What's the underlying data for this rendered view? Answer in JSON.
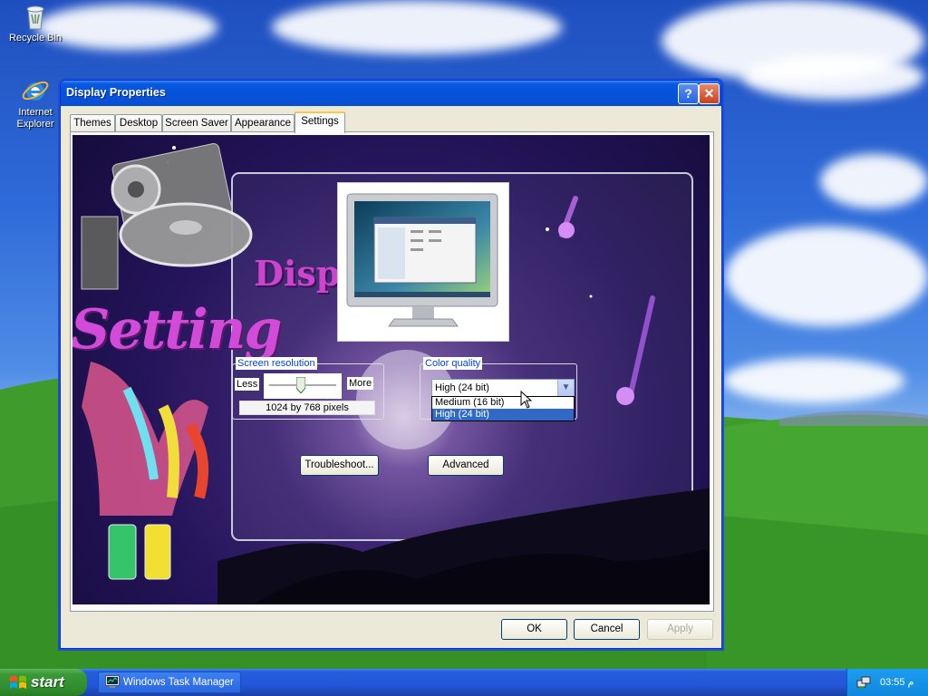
{
  "desktop": {
    "icons": [
      {
        "label": "Recycle Bin"
      },
      {
        "label": "Internet Explorer"
      }
    ]
  },
  "window": {
    "title": "Display Properties",
    "help_glyph": "?",
    "close_glyph": "✕",
    "tabs": [
      {
        "label": "Themes"
      },
      {
        "label": "Desktop"
      },
      {
        "label": "Screen Saver"
      },
      {
        "label": "Appearance"
      },
      {
        "label": "Settings",
        "active": true
      }
    ],
    "art": {
      "settings_text": "Setting",
      "display_text": "Displ"
    },
    "screen_resolution": {
      "label": "Screen resolution",
      "less_label": "Less",
      "more_label": "More",
      "value": "1024 by 768 pixels",
      "slider_fraction": 0.5
    },
    "color_quality": {
      "label": "Color quality",
      "selected": "High (24 bit)",
      "options": [
        "Medium (16 bit)",
        "High (24 bit)"
      ],
      "highlighted_index": 1
    },
    "buttons": {
      "troubleshoot": "Troubleshoot...",
      "advanced": "Advanced",
      "ok": "OK",
      "cancel": "Cancel",
      "apply": "Apply"
    }
  },
  "taskbar": {
    "start_label": "start",
    "task_item": "Windows Task Manager",
    "clock": "03:55 م"
  },
  "colors": {
    "title_bar": "#0653d9",
    "start_green": "#3a9a37",
    "highlight": "#316ac5",
    "group_label": "#0046d5"
  }
}
